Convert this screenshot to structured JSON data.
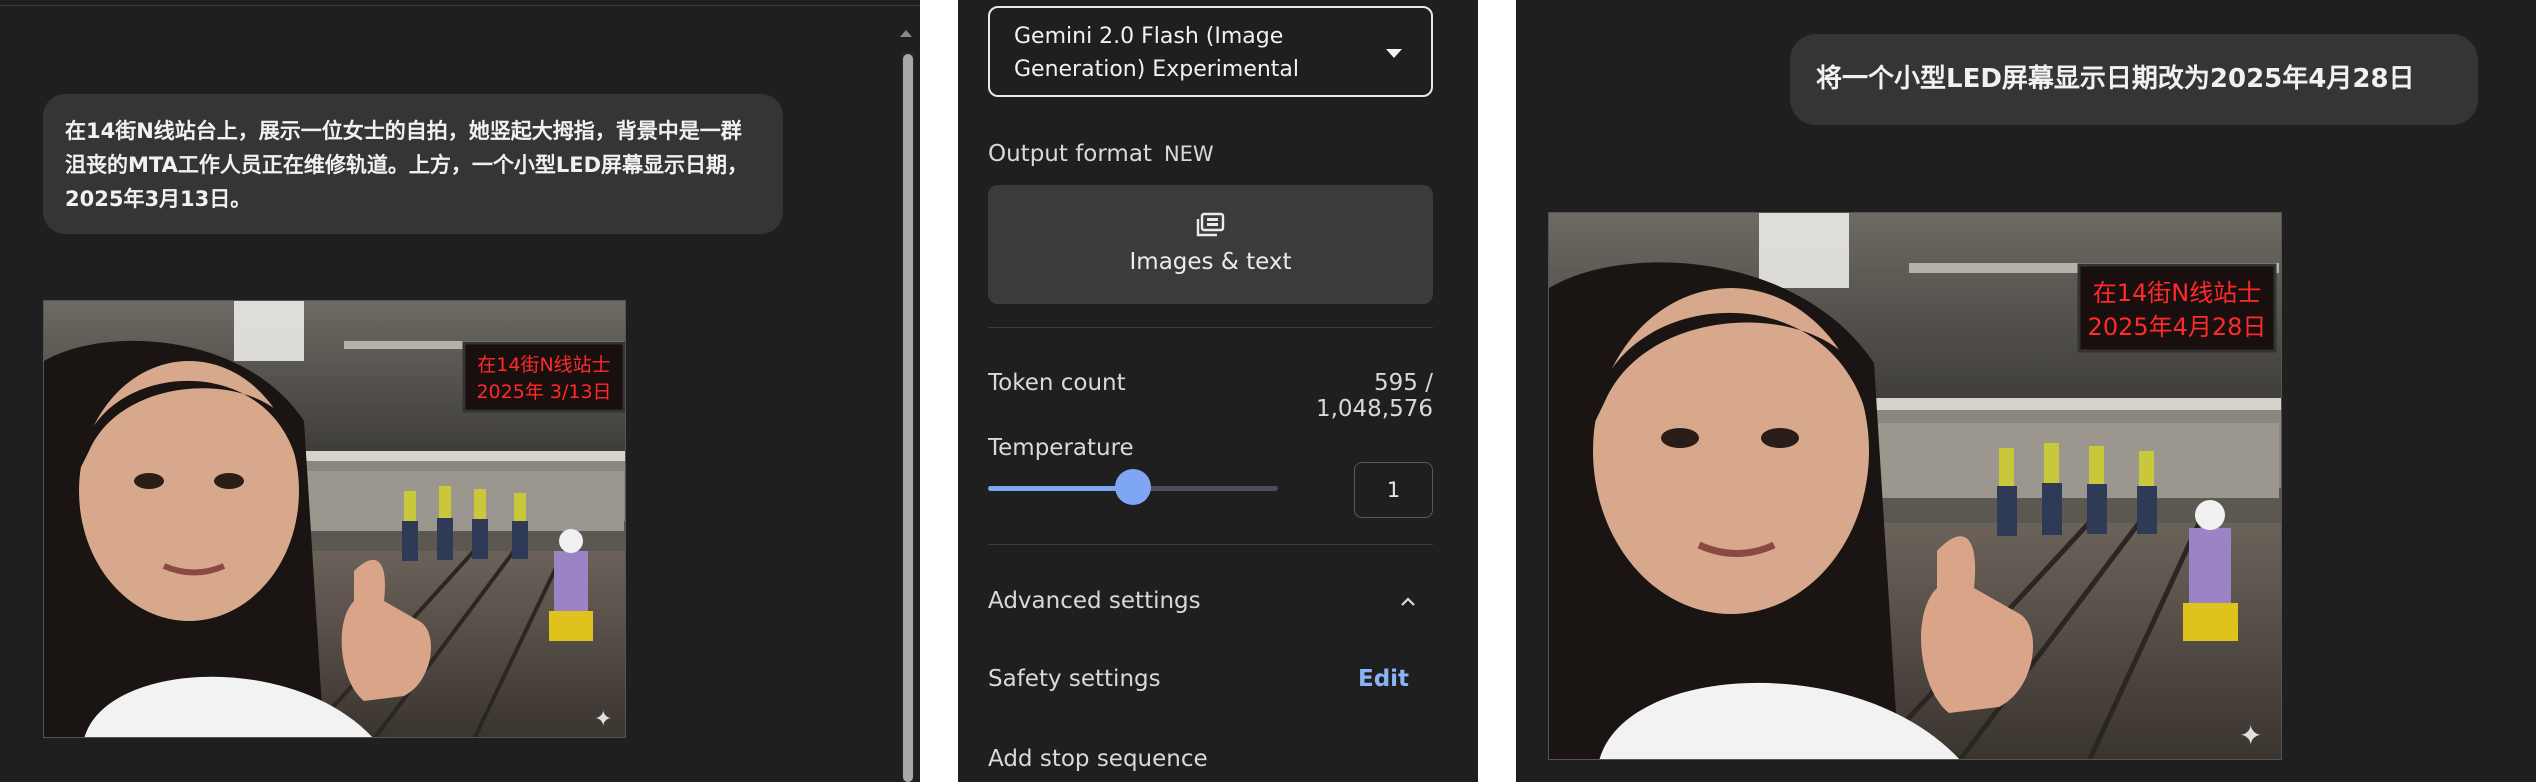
{
  "left_chat": {
    "user_prompt": "在14街N线站台上，展示一位女士的自拍，她竖起大拇指，背景中是一群沮丧的MTA工作人员正在维修轨道。上方，一个小型LED屏幕显示日期，2025年3月13日。",
    "image": {
      "led_line1": "在14街N线站士",
      "led_line2": "2025年 3/13日"
    }
  },
  "settings": {
    "model": "Gemini 2.0 Flash (Image Generation) Experimental",
    "output_format_label": "Output format",
    "new_badge": "NEW",
    "images_text_label": "Images & text",
    "token_count_label": "Token count",
    "token_count_value": "595 / 1,048,576",
    "temperature_label": "Temperature",
    "temperature_value": "1",
    "temperature_fraction": 0.5,
    "advanced_settings_label": "Advanced settings",
    "safety_settings_label": "Safety settings",
    "edit_label": "Edit",
    "stop_sequence_label": "Add stop sequence"
  },
  "right_chat": {
    "user_prompt": "将一个小型LED屏幕显示日期改为2025年4月28日",
    "image": {
      "led_line1": "在14街N线站士",
      "led_line2": "2025年4月28日"
    }
  },
  "colors": {
    "panel_bg": "#1f1f1f",
    "bubble_bg": "#333537",
    "accent": "#8ab4f8",
    "slider": "#7fa6f5",
    "led_red": "#ff2a2a"
  }
}
